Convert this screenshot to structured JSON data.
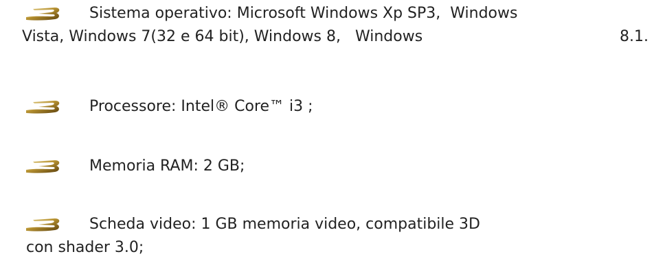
{
  "requirements": [
    {
      "first_line": "Sistema operativo: Microsoft Windows Xp SP3,  Windows",
      "second_line_parts": [
        "Vista, Windows 7(32 e 64 bit), Windows 8,   Windows",
        "8.1."
      ]
    },
    {
      "first_line": "Processore: Intel® Core™ i3 ;"
    },
    {
      "first_line": "Memoria RAM: 2 GB;"
    },
    {
      "first_line": "Scheda video: 1 GB memoria video, compatibile 3D",
      "second_line": "con shader 3.0;"
    }
  ],
  "bullet_icon": "gold-swoosh-bullet-icon",
  "colors": {
    "text": "#222222",
    "bullet_gold_light": "#d9c27a",
    "bullet_gold_dark": "#6b4f12"
  }
}
